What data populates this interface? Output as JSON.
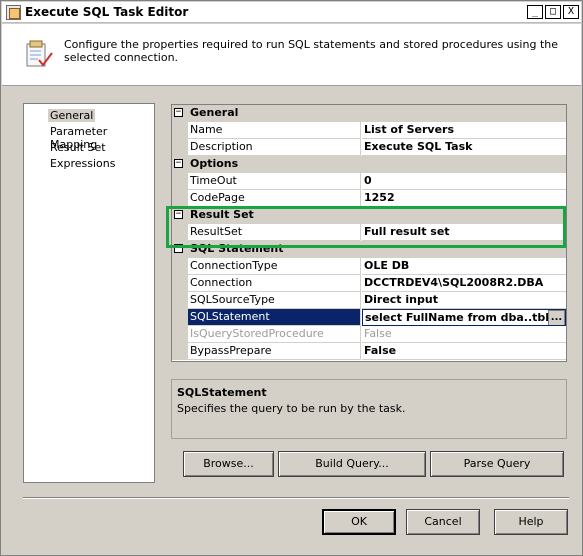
{
  "window": {
    "title": "Execute SQL Task Editor",
    "controls": {
      "minimize": "_",
      "maximize": "□",
      "close": "X"
    }
  },
  "header": {
    "description": "Configure the properties required to run SQL statements and stored procedures using the selected connection.",
    "icon": "task-editor-icon"
  },
  "nav": {
    "items": [
      {
        "label": "General",
        "selected": true
      },
      {
        "label": "Parameter Mapping",
        "selected": false
      },
      {
        "label": "Result Set",
        "selected": false
      },
      {
        "label": "Expressions",
        "selected": false
      }
    ]
  },
  "grid": {
    "categories": {
      "general": "General",
      "options": "Options",
      "result_set": "Result Set",
      "sql_statement": "SQL Statement"
    },
    "toggle_symbol": "−",
    "properties": {
      "name": {
        "label": "Name",
        "value": "List of Servers"
      },
      "description": {
        "label": "Description",
        "value": "Execute SQL Task"
      },
      "timeout": {
        "label": "TimeOut",
        "value": "0"
      },
      "codepage": {
        "label": "CodePage",
        "value": "1252"
      },
      "resultset": {
        "label": "ResultSet",
        "value": "Full result set"
      },
      "connection_type": {
        "label": "ConnectionType",
        "value": "OLE DB"
      },
      "connection": {
        "label": "Connection",
        "value": "DCCTRDEV4\\SQL2008R2.DBA"
      },
      "sql_source_type": {
        "label": "SQLSourceType",
        "value": "Direct input"
      },
      "sql_statement": {
        "label": "SQLStatement",
        "value": "select FullName from dba..tbl_List",
        "ellipsis": "..."
      },
      "is_query_sp": {
        "label": "IsQueryStoredProcedure",
        "value": "False"
      },
      "bypass_prepare": {
        "label": "BypassPrepare",
        "value": "False"
      }
    },
    "highlight_color": "#19a53f",
    "selection_color": "#0a246a"
  },
  "description_panel": {
    "title": "SQLStatement",
    "text": "Specifies the query to be run by the task."
  },
  "buttons": {
    "browse": "Browse...",
    "build_query": "Build Query...",
    "parse_query": "Parse Query",
    "ok": "OK",
    "cancel": "Cancel",
    "help": "Help"
  }
}
